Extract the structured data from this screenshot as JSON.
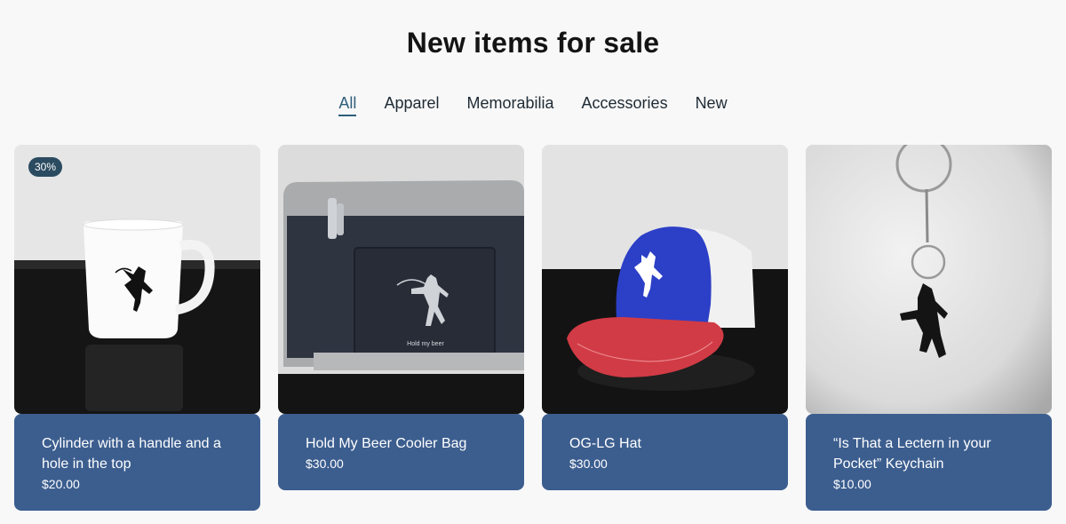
{
  "page": {
    "title": "New items for sale"
  },
  "filters": {
    "items": [
      {
        "label": "All",
        "active": true
      },
      {
        "label": "Apparel",
        "active": false
      },
      {
        "label": "Memorabilia",
        "active": false
      },
      {
        "label": "Accessories",
        "active": false
      },
      {
        "label": "New",
        "active": false
      }
    ]
  },
  "products": [
    {
      "name": "Cylinder with a handle and a hole in the top",
      "price": "$20.00",
      "badge": "30%",
      "image_icon": "mug-icon"
    },
    {
      "name": "Hold My Beer Cooler Bag",
      "price": "$30.00",
      "image_icon": "cooler-bag-icon",
      "image_text": "Hold my beer"
    },
    {
      "name": "OG-LG Hat",
      "price": "$30.00",
      "image_icon": "cap-icon"
    },
    {
      "name": "“Is That a Lectern in your Pocket” Keychain",
      "price": "$10.00",
      "image_icon": "keychain-icon"
    }
  ],
  "colors": {
    "card_info_bg": "#3c5e8f",
    "badge_bg": "#2b4b60",
    "active_tab": "#2f5f7a"
  }
}
